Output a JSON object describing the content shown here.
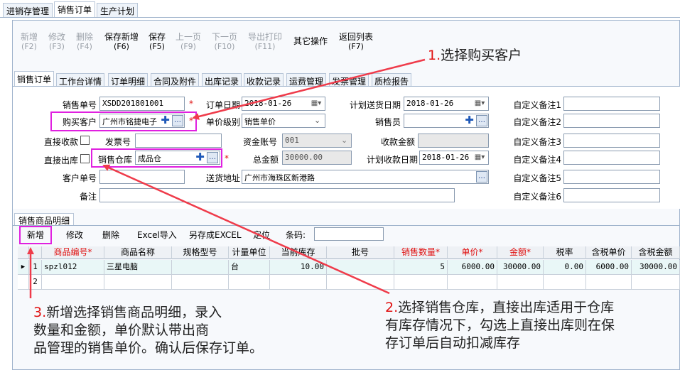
{
  "top_tabs": [
    "进销存管理",
    "销售订单",
    "生产计划"
  ],
  "toolbar": [
    {
      "label": "新增",
      "key": "(F2)",
      "disabled": true
    },
    {
      "label": "修改",
      "key": "(F3)",
      "disabled": true
    },
    {
      "label": "删除",
      "key": "(F4)",
      "disabled": true
    },
    {
      "label": "保存新增",
      "key": "(F6)",
      "disabled": false
    },
    {
      "label": "保存",
      "key": "(F5)",
      "disabled": false
    },
    {
      "label": "上一页",
      "key": "(F9)",
      "disabled": true
    },
    {
      "label": "下一页",
      "key": "(F10)",
      "disabled": true
    },
    {
      "label": "导出打印",
      "key": "(F11)",
      "disabled": true
    },
    {
      "label": "其它操作",
      "key": "",
      "disabled": false
    },
    {
      "label": "返回列表",
      "key": "(F7)",
      "disabled": false
    }
  ],
  "form_tabs": [
    "销售订单",
    "工作台详情",
    "订单明细",
    "合同及附件",
    "出库记录",
    "收款记录",
    "运费管理",
    "发票管理",
    "质检报告"
  ],
  "form": {
    "order_no_label": "销售单号",
    "order_no": "XSDD201801001",
    "order_date_label": "订单日期",
    "order_date": "2018-01-26",
    "plan_ship_label": "计划送货日期",
    "plan_ship": "2018-01-26",
    "customer_label": "购买客户",
    "customer": "广州市铭捷电子",
    "price_level_label": "单价级别",
    "price_level": "销售单价",
    "salesperson_label": "销售员",
    "direct_receipt_label": "直接收款",
    "invoice_no_label": "发票号",
    "account_label": "资金账号",
    "account": "001",
    "receipt_amount_label": "收款金额",
    "direct_out_label": "直接出库",
    "warehouse_label": "销售仓库",
    "warehouse": "成品仓",
    "total_label": "总金额",
    "total": "30000.00",
    "plan_receipt_label": "计划收款日期",
    "plan_receipt": "2018-01-26",
    "customer_no_label": "客户单号",
    "address_label": "送货地址",
    "address": "广州市海珠区新港路",
    "remark_label": "备注",
    "custom_labels": [
      "自定义备注1",
      "自定义备注2",
      "自定义备注3",
      "自定义备注4",
      "自定义备注5",
      "自定义备注6"
    ]
  },
  "grid": {
    "tab": "销售商品明细",
    "tools": [
      "新增",
      "修改",
      "删除",
      "Excel导入",
      "另存成EXCEL",
      "定位"
    ],
    "barcode_label": "条码:",
    "headers": [
      "商品编号*",
      "商品名称",
      "规格型号",
      "计量单位",
      "当前库存",
      "批号",
      "销售数量*",
      "单价*",
      "金额*",
      "税率",
      "含税单价",
      "含税金额"
    ],
    "rows": [
      {
        "idx": "1",
        "code": "spzl012",
        "name": "三星电脑",
        "spec": "",
        "unit": "台",
        "stock": "10.00",
        "batch": "",
        "qty": "5",
        "price": "6000.00",
        "amount": "30000.00",
        "tax": "0.00",
        "tax_price": "6000.00",
        "tax_amount": "30000.00"
      },
      {
        "idx": "2",
        "code": "",
        "name": "",
        "spec": "",
        "unit": "",
        "stock": "",
        "batch": "",
        "qty": "",
        "price": "",
        "amount": "",
        "tax": "",
        "tax_price": "",
        "tax_amount": ""
      }
    ]
  },
  "notes": {
    "n1_num": "1.",
    "n1": "选择购买客户",
    "n2_num": "2.",
    "n2_l1": "选择销售仓库，直接出库适用于仓库",
    "n2_l2": "有库存情况下，勾选上直接出库则在保",
    "n2_l3": "存订单后自动扣减库存",
    "n3_num": "3.",
    "n3_l1": "新增选择销售商品明细，录入",
    "n3_l2": "数量和金额，单价默认带出商",
    "n3_l3": "品管理的销售单价。确认后保存订单。"
  },
  "colors": {
    "accent": "#e020e0",
    "arrow": "#ef3b4a",
    "star": "#e01010"
  }
}
